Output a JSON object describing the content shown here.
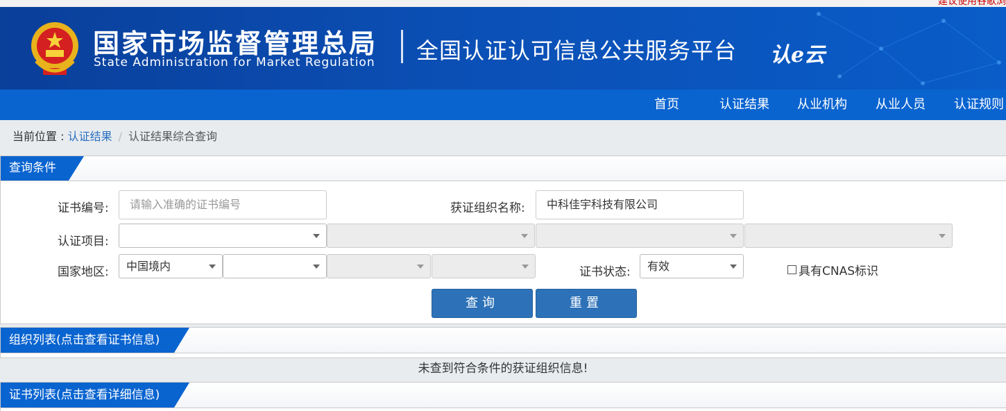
{
  "top_notice": "建议使用谷歌浏",
  "header": {
    "org_name_cn": "国家市场监督管理总局",
    "org_name_en": "State Administration  for  Market Regulation",
    "platform_title": "全国认证认可信息公共服务平台",
    "platform_logo": "认e云",
    "emblem_icon": "national-emblem-icon",
    "primary_color": "#0a4fb5"
  },
  "nav": {
    "items": [
      "首页",
      "认证结果",
      "从业机构",
      "从业人员",
      "认证规则"
    ],
    "bg_color": "#0a64d0"
  },
  "breadcrumb": {
    "prefix": "当前位置 : ",
    "link": "认证结果",
    "separator": "/",
    "current": "认证结果综合查询"
  },
  "query_panel": {
    "title": "查询条件",
    "cert_no_label": "证书编号:",
    "cert_no_placeholder": "请输入准确的证书编号",
    "cert_no_value": "",
    "org_name_label": "获证组织名称:",
    "org_name_value": "中科佳宇科技有限公司",
    "project_label": "认证项目:",
    "project_selects": [
      "",
      "",
      "",
      ""
    ],
    "region_label": "国家地区:",
    "region_selects": [
      "中国境内",
      "",
      "",
      ""
    ],
    "status_label": "证书状态:",
    "status_value": "有效",
    "cnas_label": "具有CNAS标识",
    "cnas_checked": false,
    "search_button": "查询",
    "reset_button": "重置"
  },
  "org_panel": {
    "title": "组织列表(点击查看证书信息)",
    "empty_message": "未查到符合条件的获证组织信息!"
  },
  "cert_panel": {
    "title": "证书列表(点击查看详细信息)"
  }
}
